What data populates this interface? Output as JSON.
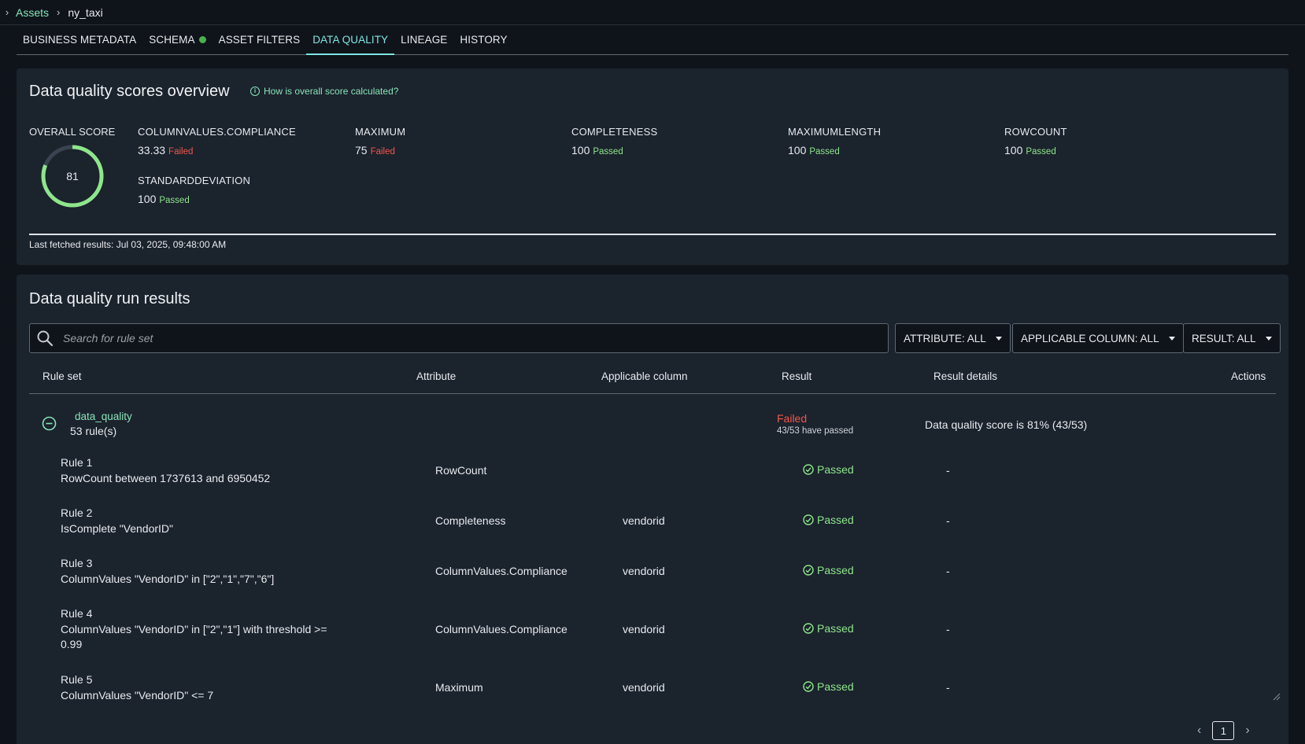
{
  "breadcrumb": {
    "items": [
      "Assets",
      "ny_taxi"
    ]
  },
  "tabs": [
    {
      "label": "BUSINESS METADATA"
    },
    {
      "label": "SCHEMA"
    },
    {
      "label": "ASSET FILTERS"
    },
    {
      "label": "DATA QUALITY",
      "active": true
    },
    {
      "label": "LINEAGE"
    },
    {
      "label": "HISTORY"
    }
  ],
  "overview": {
    "title": "Data quality scores overview",
    "help_link": "How is overall score calculated?",
    "overall_label": "OVERALL SCORE",
    "overall_score": "81",
    "overall_score_value": 81,
    "metrics": [
      {
        "name": "COLUMNVALUES.COMPLIANCE",
        "value": "33.33",
        "status": "Failed"
      },
      {
        "name": "MAXIMUM",
        "value": "75",
        "status": "Failed"
      },
      {
        "name": "COMPLETENESS",
        "value": "100",
        "status": "Passed"
      },
      {
        "name": "MAXIMUMLENGTH",
        "value": "100",
        "status": "Passed"
      },
      {
        "name": "ROWCOUNT",
        "value": "100",
        "status": "Passed"
      },
      {
        "name": "STANDARDDEVIATION",
        "value": "100",
        "status": "Passed"
      }
    ],
    "last_fetched": "Last fetched results: Jul 03, 2025, 09:48:00 AM"
  },
  "results": {
    "title": "Data quality run results",
    "search_placeholder": "Search for rule set",
    "filters": {
      "attribute": "ATTRIBUTE: ALL",
      "column": "APPLICABLE COLUMN: ALL",
      "result": "RESULT: ALL"
    },
    "columns": {
      "rule_set": "Rule set",
      "attribute": "Attribute",
      "applicable_column": "Applicable column",
      "result": "Result",
      "result_details": "Result details",
      "actions": "Actions"
    },
    "group": {
      "name": "data_quality",
      "count": "53 rule(s)",
      "result": "Failed",
      "result_sub": "43/53 have passed",
      "details": "Data quality score is 81% (43/53)"
    },
    "rules": [
      {
        "name": "Rule 1",
        "desc": "RowCount between 1737613 and 6950452",
        "attribute": "RowCount",
        "column": "",
        "result": "Passed",
        "details": "-"
      },
      {
        "name": "Rule 2",
        "desc": "IsComplete \"VendorID\"",
        "attribute": "Completeness",
        "column": "vendorid",
        "result": "Passed",
        "details": "-"
      },
      {
        "name": "Rule 3",
        "desc": "ColumnValues \"VendorID\" in [\"2\",\"1\",\"7\",\"6\"]",
        "attribute": "ColumnValues.Compliance",
        "column": "vendorid",
        "result": "Passed",
        "details": "-"
      },
      {
        "name": "Rule 4",
        "desc": "ColumnValues \"VendorID\" in [\"2\",\"1\"] with threshold >= 0.99",
        "attribute": "ColumnValues.Compliance",
        "column": "vendorid",
        "result": "Passed",
        "details": "-"
      },
      {
        "name": "Rule 5",
        "desc": "ColumnValues \"VendorID\" <= 7",
        "attribute": "Maximum",
        "column": "vendorid",
        "result": "Passed",
        "details": "-"
      }
    ],
    "pagination": {
      "current": "1"
    }
  }
}
